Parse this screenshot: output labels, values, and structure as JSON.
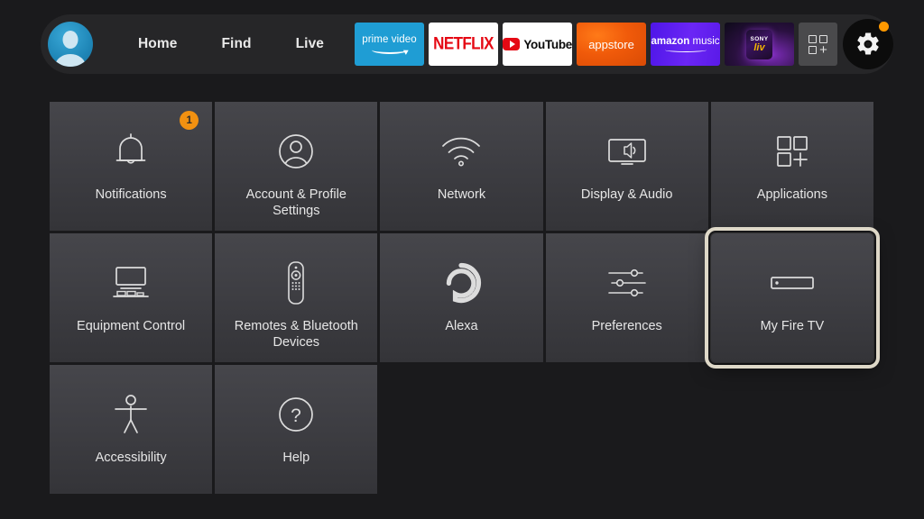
{
  "topbar": {
    "avatar": {
      "name": "profile-avatar"
    },
    "nav": [
      {
        "label": "Home"
      },
      {
        "label": "Find"
      },
      {
        "label": "Live"
      }
    ],
    "apps": [
      {
        "name": "prime-video",
        "line1": "prime video"
      },
      {
        "name": "netflix",
        "line1": "NETFLIX"
      },
      {
        "name": "youtube",
        "line1": "YouTube"
      },
      {
        "name": "appstore",
        "line1": "appstore"
      },
      {
        "name": "amazon-music",
        "line1": "amazon",
        "line2": "music"
      },
      {
        "name": "sony-liv",
        "line1": "SONY",
        "line2": "liv"
      }
    ],
    "app_grid_button": {
      "name": "app-grid-button"
    },
    "settings_button": {
      "name": "settings-gear-button",
      "notification_dot": true
    }
  },
  "settings_grid": {
    "tiles": [
      {
        "label": "Notifications",
        "icon": "bell-icon",
        "badge": "1",
        "selected": false
      },
      {
        "label": "Account & Profile Settings",
        "icon": "person-icon",
        "badge": null,
        "selected": false
      },
      {
        "label": "Network",
        "icon": "wifi-icon",
        "badge": null,
        "selected": false
      },
      {
        "label": "Display & Audio",
        "icon": "tv-speaker-icon",
        "badge": null,
        "selected": false
      },
      {
        "label": "Applications",
        "icon": "apps-plus-icon",
        "badge": null,
        "selected": false
      },
      {
        "label": "Equipment Control",
        "icon": "tv-stand-icon",
        "badge": null,
        "selected": false
      },
      {
        "label": "Remotes & Bluetooth Devices",
        "icon": "remote-icon",
        "badge": null,
        "selected": false
      },
      {
        "label": "Alexa",
        "icon": "alexa-ring-icon",
        "badge": null,
        "selected": false
      },
      {
        "label": "Preferences",
        "icon": "sliders-icon",
        "badge": null,
        "selected": false
      },
      {
        "label": "My Fire TV",
        "icon": "firetv-stick-icon",
        "badge": null,
        "selected": true
      },
      {
        "label": "Accessibility",
        "icon": "accessibility-icon",
        "badge": null,
        "selected": false
      },
      {
        "label": "Help",
        "icon": "question-mark-icon",
        "badge": null,
        "selected": false
      }
    ]
  },
  "colors": {
    "background": "#1a1a1c",
    "topbar_background": "#262628",
    "tile_top": "#46464b",
    "tile_bottom": "#343438",
    "selection_border": "#ded8c8",
    "badge_orange": "#f29111",
    "notification_dot": "#ff9900",
    "avatar_blue": "#1f87b8"
  }
}
